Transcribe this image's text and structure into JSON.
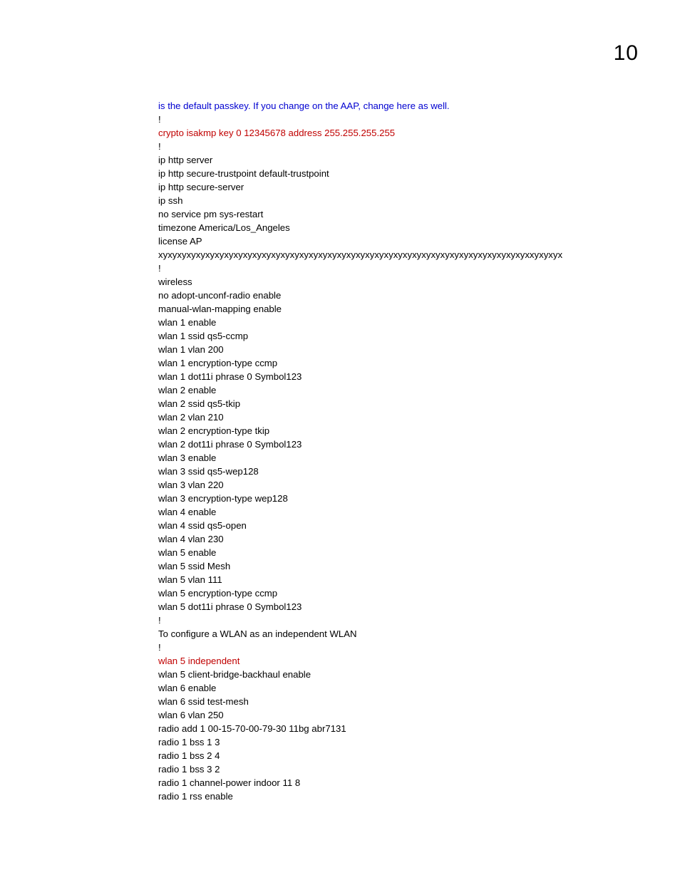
{
  "pageNumber": "10",
  "lines": [
    {
      "text": "is the default passkey. If you change on the AAP, change here as well.",
      "color": "blue"
    },
    {
      "text": "!",
      "color": "black"
    },
    {
      "text": "crypto isakmp key 0 12345678 address 255.255.255.255",
      "color": "red"
    },
    {
      "text": "!",
      "color": "black"
    },
    {
      "text": "ip http server",
      "color": "black"
    },
    {
      "text": "ip http secure-trustpoint default-trustpoint",
      "color": "black"
    },
    {
      "text": "ip http secure-server",
      "color": "black"
    },
    {
      "text": "ip ssh",
      "color": "black"
    },
    {
      "text": "no service pm sys-restart",
      "color": "black"
    },
    {
      "text": "timezone America/Los_Angeles",
      "color": "black"
    },
    {
      "text": "license AP",
      "color": "black"
    },
    {
      "text": "xyxyxyxyxyxyxyxyxyxyxyxyxyxyxyxyxyxyxyxyxyxyxyxyxyxyxyxyxyxyxyxyxyxyxyxyxyxyxyxxyxyxyx",
      "color": "black"
    },
    {
      "text": "!",
      "color": "black"
    },
    {
      "text": "wireless",
      "color": "black"
    },
    {
      "text": "no adopt-unconf-radio enable",
      "color": "black"
    },
    {
      "text": "manual-wlan-mapping enable",
      "color": "black"
    },
    {
      "text": "wlan 1 enable",
      "color": "black"
    },
    {
      "text": "wlan 1 ssid qs5-ccmp",
      "color": "black"
    },
    {
      "text": "wlan 1 vlan 200",
      "color": "black"
    },
    {
      "text": "wlan 1 encryption-type ccmp",
      "color": "black"
    },
    {
      "text": "wlan 1 dot11i phrase 0 Symbol123",
      "color": "black"
    },
    {
      "text": "wlan 2 enable",
      "color": "black"
    },
    {
      "text": "wlan 2 ssid qs5-tkip",
      "color": "black"
    },
    {
      "text": "wlan 2 vlan 210",
      "color": "black"
    },
    {
      "text": "wlan 2 encryption-type tkip",
      "color": "black"
    },
    {
      "text": "wlan 2 dot11i phrase 0 Symbol123",
      "color": "black"
    },
    {
      "text": "wlan 3 enable",
      "color": "black"
    },
    {
      "text": "wlan 3 ssid qs5-wep128",
      "color": "black"
    },
    {
      "text": "wlan 3 vlan 220",
      "color": "black"
    },
    {
      "text": "wlan 3 encryption-type wep128",
      "color": "black"
    },
    {
      "text": "wlan 4 enable",
      "color": "black"
    },
    {
      "text": "wlan 4 ssid qs5-open",
      "color": "black"
    },
    {
      "text": "wlan 4 vlan 230",
      "color": "black"
    },
    {
      "text": "wlan 5 enable",
      "color": "black"
    },
    {
      "text": "wlan 5 ssid Mesh",
      "color": "black"
    },
    {
      "text": "wlan 5 vlan 111",
      "color": "black"
    },
    {
      "text": "wlan 5 encryption-type ccmp",
      "color": "black"
    },
    {
      "text": "wlan 5 dot11i phrase 0 Symbol123",
      "color": "black"
    },
    {
      "text": "!",
      "color": "black"
    },
    {
      "text": "To configure a WLAN as an independent WLAN",
      "color": "black"
    },
    {
      "text": "!",
      "color": "black"
    },
    {
      "text": "wlan 5 independent",
      "color": "red"
    },
    {
      "text": "wlan 5 client-bridge-backhaul enable",
      "color": "black"
    },
    {
      "text": "wlan 6 enable",
      "color": "black"
    },
    {
      "text": "wlan 6 ssid test-mesh",
      "color": "black"
    },
    {
      "text": "wlan 6 vlan 250",
      "color": "black"
    },
    {
      "text": "radio add 1 00-15-70-00-79-30 11bg abr7131",
      "color": "black"
    },
    {
      "text": "radio 1 bss 1 3",
      "color": "black"
    },
    {
      "text": "radio 1 bss 2 4",
      "color": "black"
    },
    {
      "text": "radio 1 bss 3 2",
      "color": "black"
    },
    {
      "text": "radio 1 channel-power indoor 11 8",
      "color": "black"
    },
    {
      "text": "radio 1 rss enable",
      "color": "black"
    }
  ]
}
